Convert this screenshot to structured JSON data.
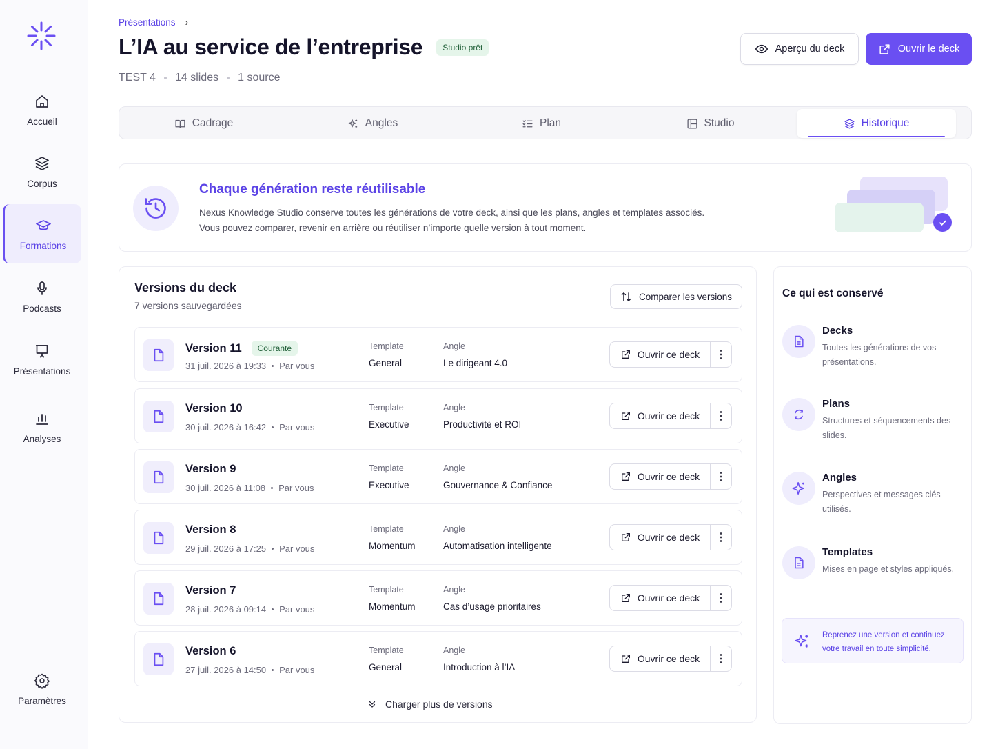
{
  "sidebar": {
    "items": [
      {
        "label": "Accueil",
        "icon": "home-icon"
      },
      {
        "label": "Corpus",
        "icon": "layers-icon"
      },
      {
        "label": "Formations",
        "icon": "graduation-cap-icon"
      },
      {
        "label": "Podcasts",
        "icon": "microphone-icon"
      },
      {
        "label": "Présentations",
        "icon": "presentation-icon"
      },
      {
        "label": "Analyses",
        "icon": "bar-chart-icon"
      }
    ],
    "settings": {
      "label": "Paramètres",
      "icon": "gear-icon"
    },
    "active_index": 2
  },
  "breadcrumb": {
    "parent": "Présentations"
  },
  "header": {
    "title": "L’IA au service de l’entreprise",
    "status_badge": "Studio prêt",
    "meta": [
      "TEST 4",
      "14 slides",
      "1 source"
    ],
    "preview_button": "Aperçu du deck",
    "open_button": "Ouvrir le deck"
  },
  "tabs": [
    {
      "label": "Cadrage",
      "icon": "book-open-icon"
    },
    {
      "label": "Angles",
      "icon": "sparkles-icon"
    },
    {
      "label": "Plan",
      "icon": "list-checks-icon"
    },
    {
      "label": "Studio",
      "icon": "layout-icon"
    },
    {
      "label": "Historique",
      "icon": "layers-icon"
    }
  ],
  "active_tab": "Historique",
  "banner": {
    "title": "Chaque génération reste réutilisable",
    "line1": "Nexus Knowledge Studio conserve toutes les générations de votre deck, ainsi que les plans, angles et templates associés.",
    "line2": "Vous pouvez comparer, revenir en arrière ou réutiliser n’importe quelle version à tout moment."
  },
  "versions": {
    "title": "Versions du deck",
    "subtitle": "7 versions sauvegardées",
    "compare_button": "Comparer les versions",
    "template_label": "Template",
    "angle_label": "Angle",
    "open_label": "Ouvrir ce deck",
    "current_badge": "Courante",
    "load_more": "Charger plus de versions",
    "rows": [
      {
        "name": "Version 11",
        "date": "31 juil. 2026 à 19:33",
        "author": "Par vous",
        "template": "General",
        "angle": "Le dirigeant 4.0",
        "current": true
      },
      {
        "name": "Version 10",
        "date": "30 juil. 2026 à 16:42",
        "author": "Par vous",
        "template": "Executive",
        "angle": "Productivité et ROI",
        "current": false
      },
      {
        "name": "Version 9",
        "date": "30 juil. 2026 à 11:08",
        "author": "Par vous",
        "template": "Executive",
        "angle": "Gouvernance & Confiance",
        "current": false
      },
      {
        "name": "Version 8",
        "date": "29 juil. 2026 à 17:25",
        "author": "Par vous",
        "template": "Momentum",
        "angle": "Automatisation intelligente",
        "current": false
      },
      {
        "name": "Version 7",
        "date": "28 juil. 2026 à 09:14",
        "author": "Par vous",
        "template": "Momentum",
        "angle": "Cas d’usage prioritaires",
        "current": false
      },
      {
        "name": "Version 6",
        "date": "27 juil. 2026 à 14:50",
        "author": "Par vous",
        "template": "General",
        "angle": "Introduction à l’IA",
        "current": false
      }
    ]
  },
  "kept": {
    "title": "Ce qui est conservé",
    "items": [
      {
        "name": "Decks",
        "desc": "Toutes les générations de vos présentations.",
        "icon": "file-icon"
      },
      {
        "name": "Plans",
        "desc": "Structures et séquencements des slides.",
        "icon": "cycle-icon"
      },
      {
        "name": "Angles",
        "desc": "Perspectives et messages clés utilisés.",
        "icon": "sparkle-icon"
      },
      {
        "name": "Templates",
        "desc": "Mises en page et styles appliqués.",
        "icon": "file-icon"
      }
    ],
    "tip": "Reprenez une version et continuez votre travail en toute simplicité."
  },
  "colors": {
    "accent": "#6a4ff2",
    "accent_text": "#5b43e6",
    "success_bg": "#e5f5ea",
    "success_text": "#22613a"
  }
}
